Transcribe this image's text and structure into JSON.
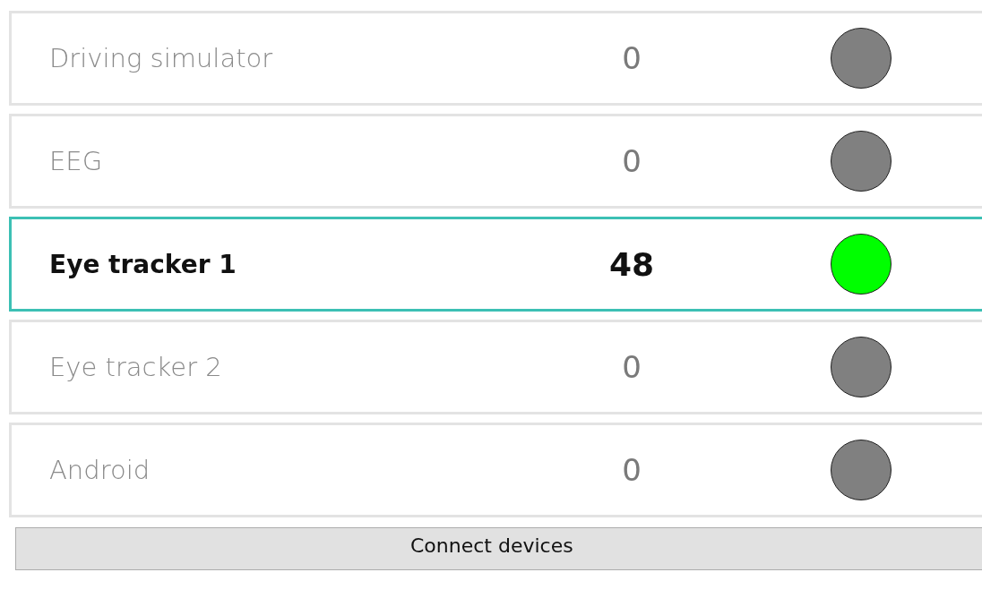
{
  "devices": [
    {
      "name": "Driving simulator",
      "count": "0",
      "selected": false,
      "color": "#808080"
    },
    {
      "name": "EEG",
      "count": "0",
      "selected": false,
      "color": "#808080"
    },
    {
      "name": "Eye tracker 1",
      "count": "48",
      "selected": true,
      "color": "#00ff00"
    },
    {
      "name": "Eye tracker 2",
      "count": "0",
      "selected": false,
      "color": "#808080"
    },
    {
      "name": "Android",
      "count": "0",
      "selected": false,
      "color": "#808080"
    }
  ],
  "connect_button": {
    "label": "Connect devices"
  }
}
